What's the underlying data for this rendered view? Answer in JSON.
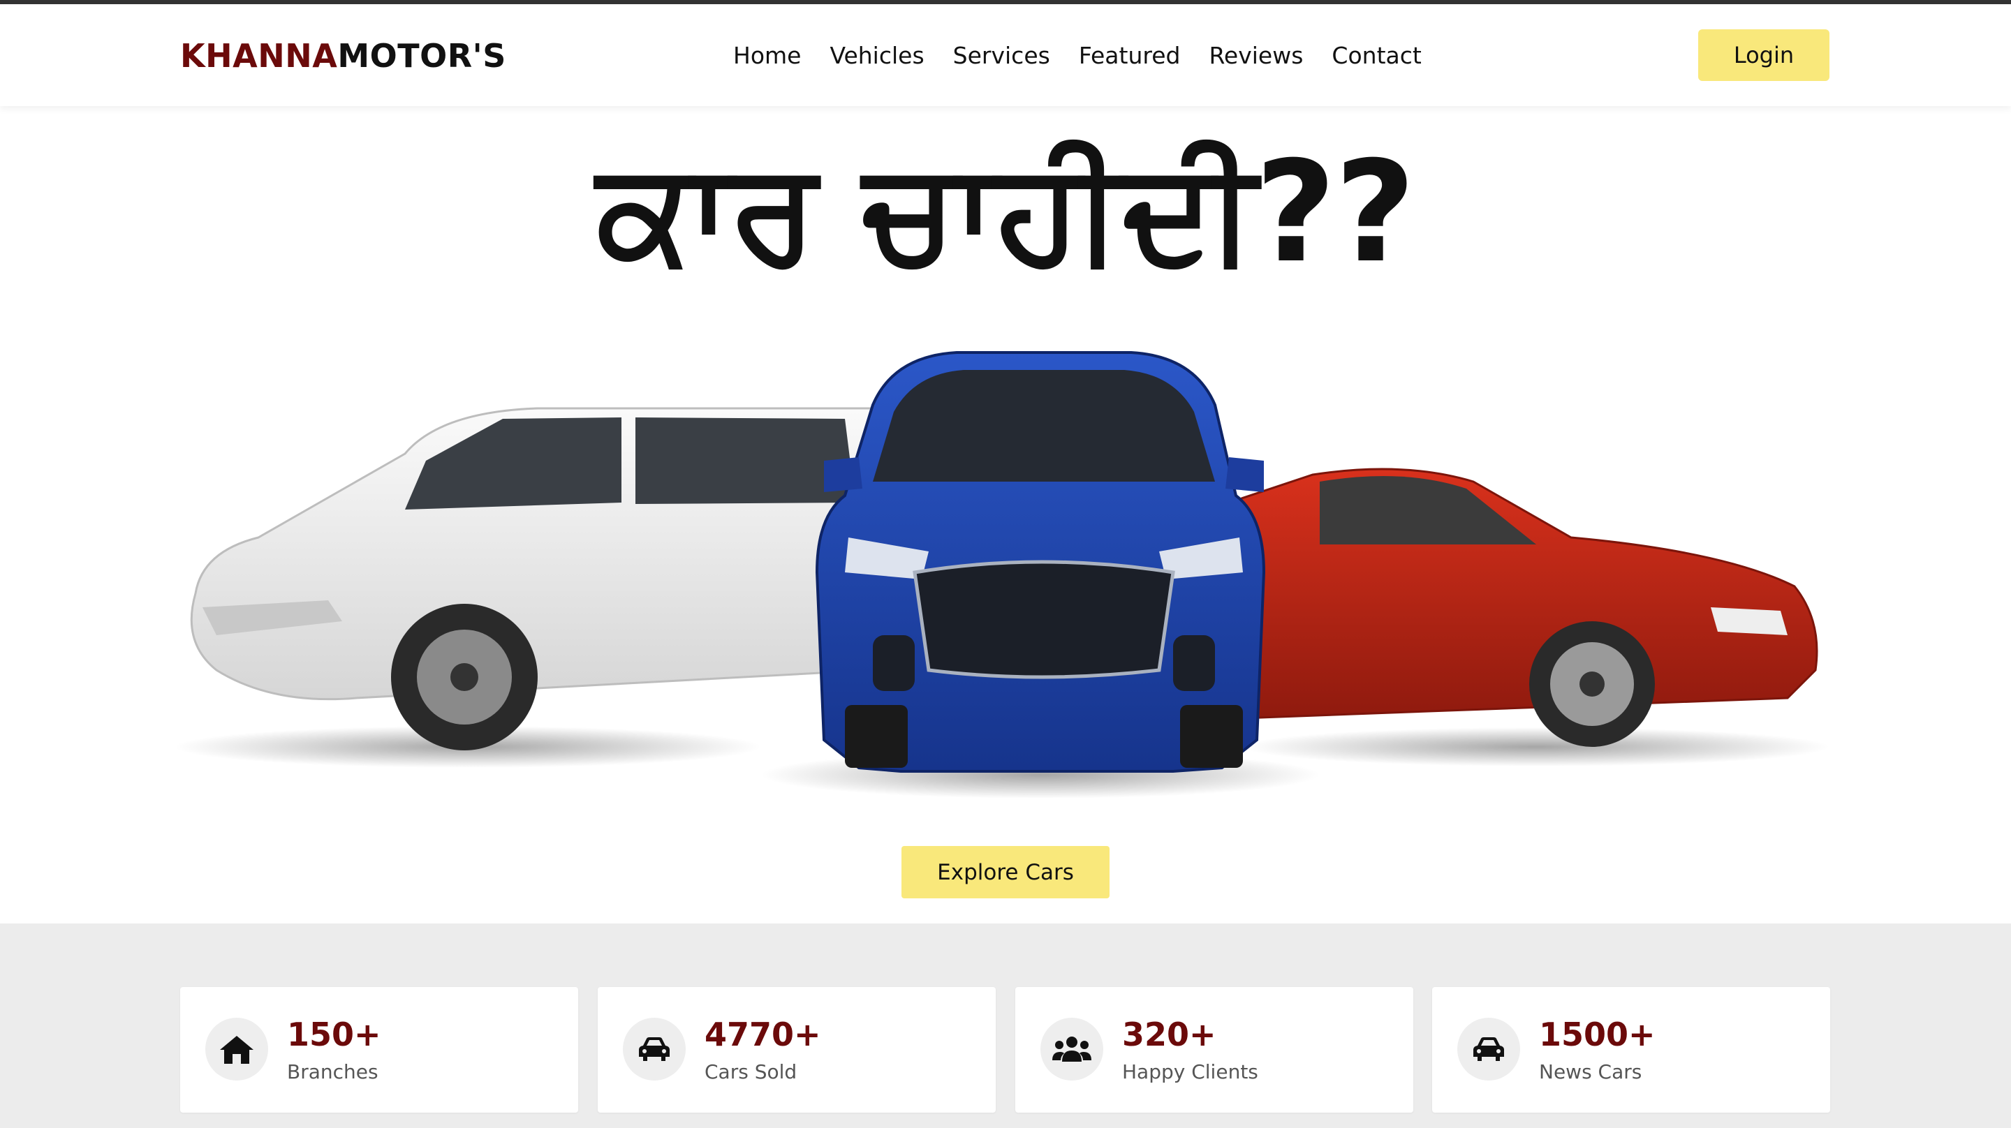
{
  "header": {
    "logo_part1": "KHANNA",
    "logo_part2": "MOTOR'S",
    "nav": [
      "Home",
      "Vehicles",
      "Services",
      "Featured",
      "Reviews",
      "Contact"
    ],
    "login_label": "Login"
  },
  "hero": {
    "title": "ਕਾਰ ਚਾਹੀਦੀ??",
    "explore_label": "Explore Cars"
  },
  "stats": [
    {
      "value": "150+",
      "label": "Branches",
      "icon": "home-icon"
    },
    {
      "value": "4770+",
      "label": "Cars Sold",
      "icon": "car-icon"
    },
    {
      "value": "320+",
      "label": "Happy Clients",
      "icon": "users-icon"
    },
    {
      "value": "1500+",
      "label": "News Cars",
      "icon": "car-icon"
    }
  ],
  "colors": {
    "brand": "#6b0a0a",
    "accent": "#f9e87b",
    "band": "#ececec"
  }
}
